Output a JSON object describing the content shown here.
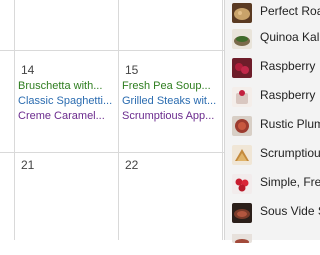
{
  "calendar": {
    "colors": {
      "green": "#2e7d1f",
      "blue": "#2b6cb0",
      "purple": "#6b2b8e",
      "grid": "#d9d9d9"
    },
    "week1": {
      "days": [
        {
          "date": "14",
          "events": [
            "Bruschetta with...",
            "Classic Spaghetti...",
            "Creme Caramel..."
          ]
        },
        {
          "date": "15",
          "events": [
            "Fresh Pea Soup...",
            "Grilled Steaks wit...",
            "Scrumptious App..."
          ]
        }
      ]
    },
    "week2": {
      "days": [
        {
          "date": "21"
        },
        {
          "date": "22"
        }
      ]
    }
  },
  "sidebar": {
    "items": [
      {
        "label": "Perfect Roa",
        "thumb": "salad-thumbnail-icon"
      },
      {
        "label": "Quinoa Kal",
        "thumb": "bowl-thumbnail-icon"
      },
      {
        "label": "Raspberry",
        "thumb": "berry-thumbnail-icon"
      },
      {
        "label": "Raspberry",
        "thumb": "dessert-thumbnail-icon"
      },
      {
        "label": "Rustic Plum",
        "thumb": "tart-thumbnail-icon"
      },
      {
        "label": "Scrumptiou",
        "thumb": "pie-thumbnail-icon"
      },
      {
        "label": "Simple, Fre",
        "thumb": "strawberry-thumbnail-icon"
      },
      {
        "label": "Sous Vide S",
        "thumb": "steak-thumbnail-icon"
      }
    ]
  }
}
